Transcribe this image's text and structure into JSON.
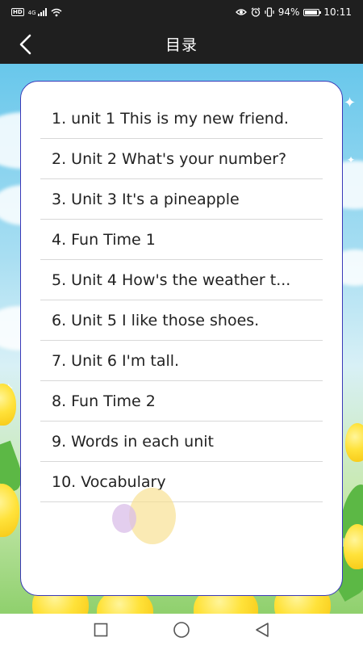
{
  "status_bar": {
    "hd": "HD",
    "network": "4G",
    "battery_percent": "94%",
    "battery_level": 0.94,
    "time": "10:11",
    "icons": [
      "hd-badge",
      "signal-icon",
      "wifi-icon",
      "eye-icon",
      "alarm-icon",
      "vibrate-icon",
      "battery-icon"
    ]
  },
  "header": {
    "title": "目录",
    "back_icon": "chevron-left-icon"
  },
  "toc": {
    "items": [
      {
        "label": "1. unit 1 This is my new friend."
      },
      {
        "label": "2. Unit 2 What's your number?"
      },
      {
        "label": "3. Unit 3 It's a pineapple"
      },
      {
        "label": "4. Fun Time 1"
      },
      {
        "label": "5. Unit 4 How's the weather t..."
      },
      {
        "label": "6. Unit 5 I like those shoes."
      },
      {
        "label": "7. Unit 6 I'm tall."
      },
      {
        "label": "8. Fun Time 2"
      },
      {
        "label": "9. Words in each unit"
      },
      {
        "label": "10. Vocabulary"
      }
    ]
  },
  "nav_bar": {
    "icons": [
      "recents-square-icon",
      "home-circle-icon",
      "back-triangle-icon"
    ]
  },
  "colors": {
    "bar_background": "#1f1f1f",
    "card_border": "#3a3ab8",
    "sky": "#68c7eb",
    "flower_yellow": "#ffe23a"
  }
}
